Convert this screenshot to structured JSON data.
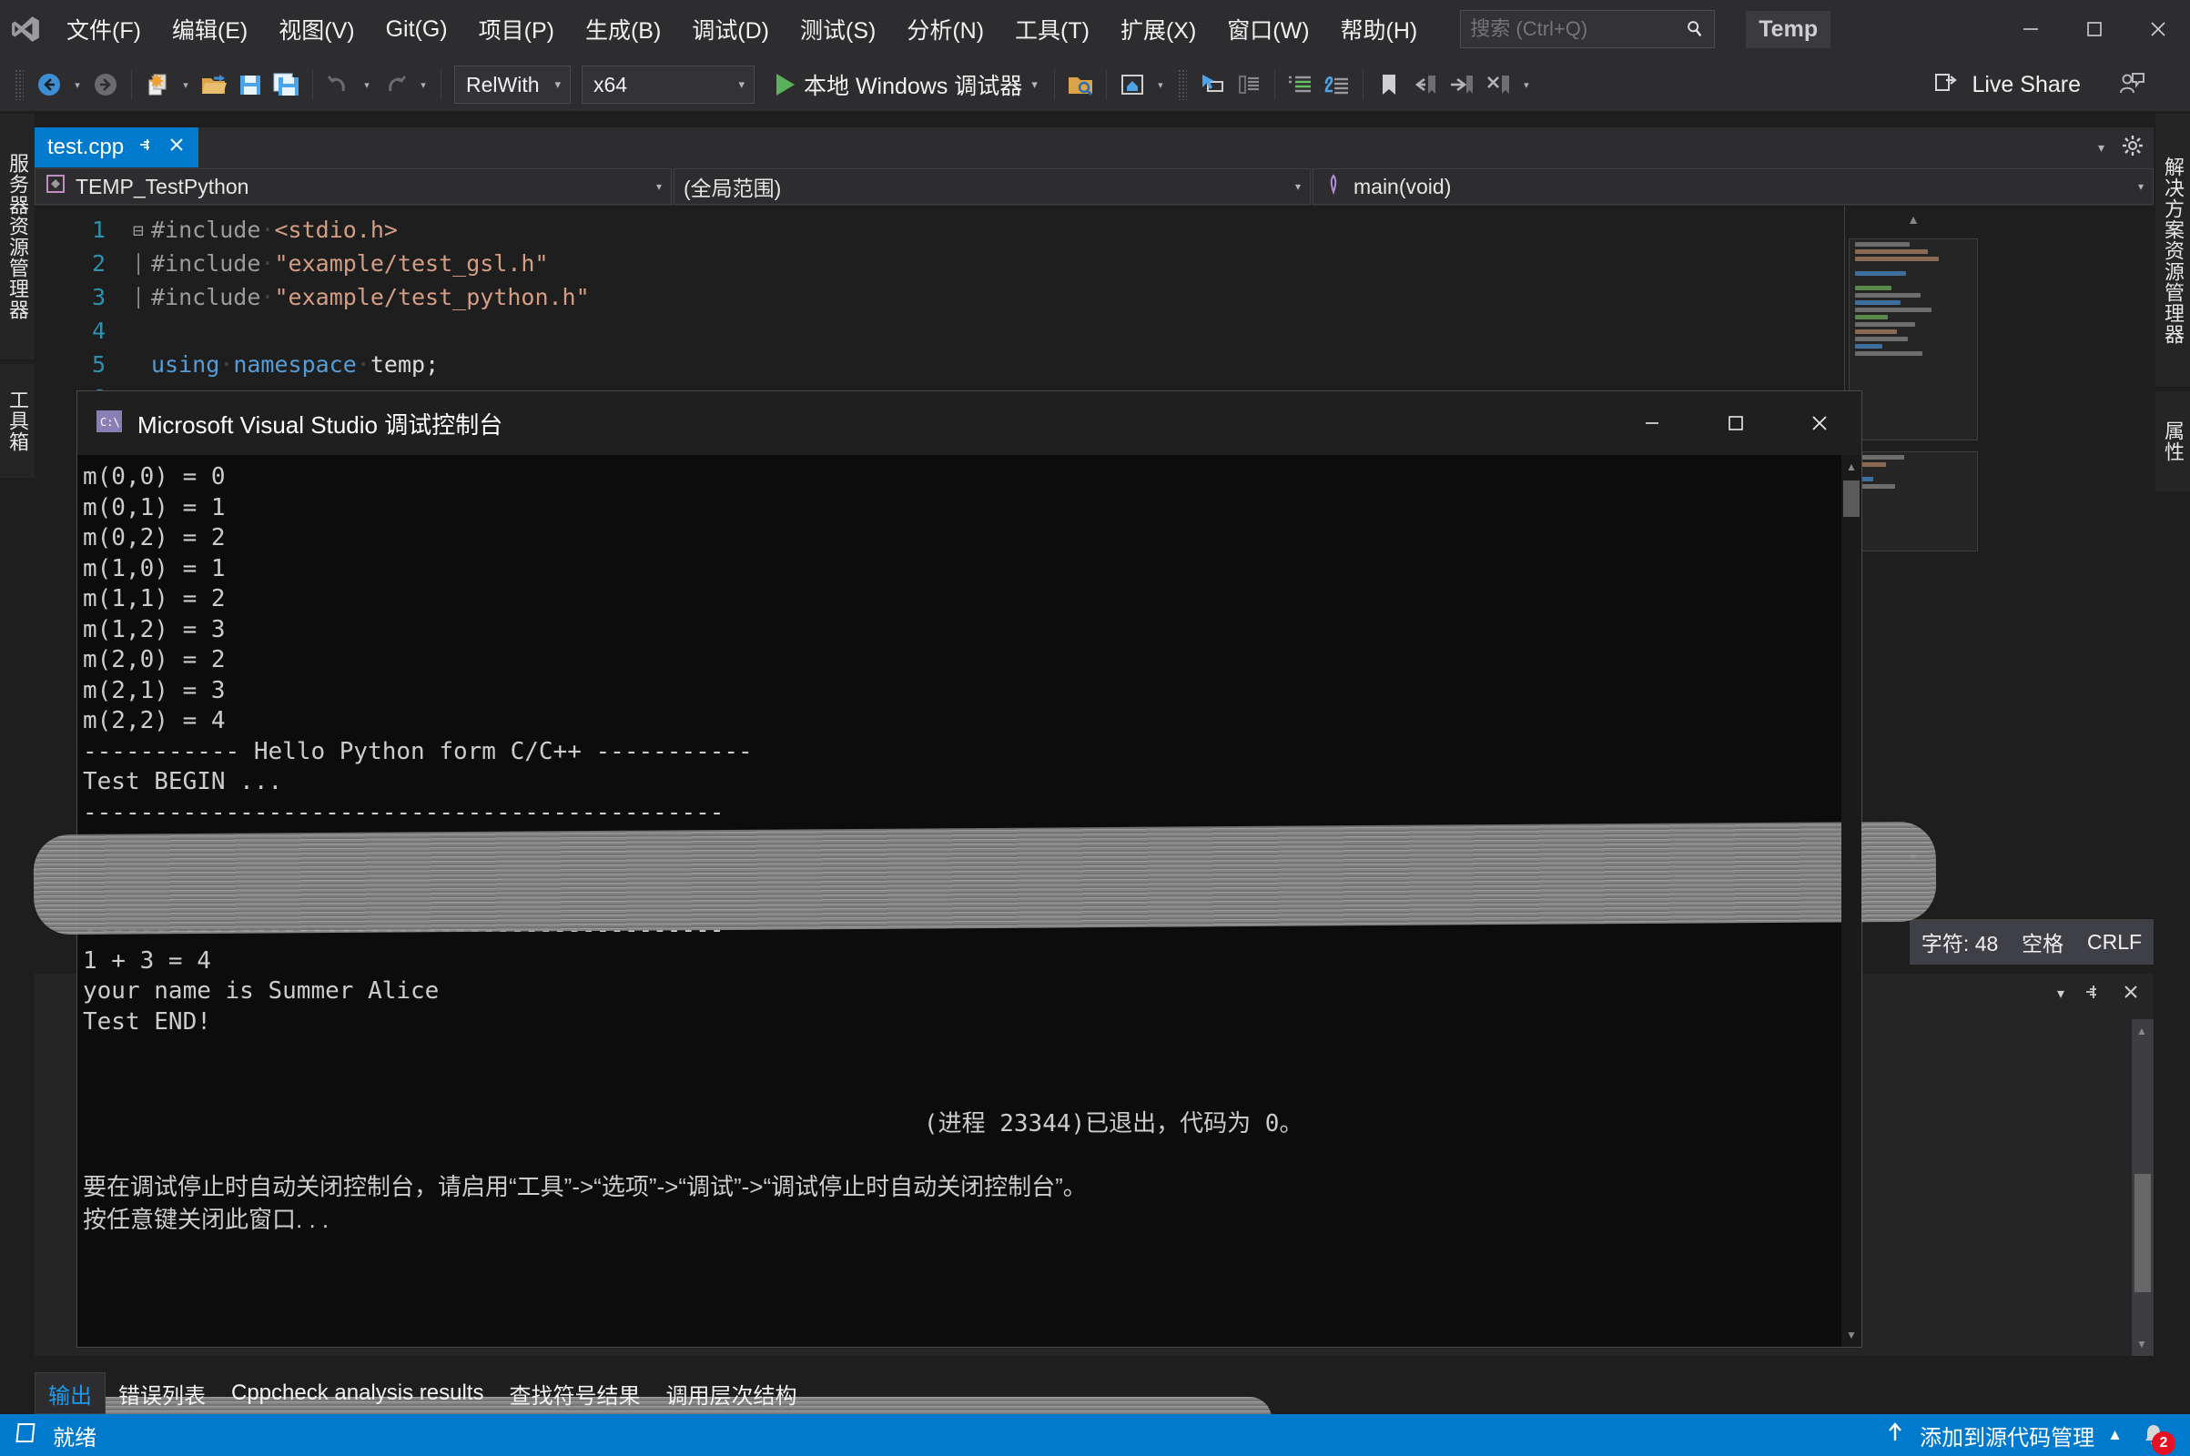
{
  "app": {
    "title_badge": "Temp",
    "live_share": "Live Share"
  },
  "menu": {
    "items": [
      {
        "label": "文件(F)"
      },
      {
        "label": "编辑(E)"
      },
      {
        "label": "视图(V)"
      },
      {
        "label": "Git(G)"
      },
      {
        "label": "项目(P)"
      },
      {
        "label": "生成(B)"
      },
      {
        "label": "调试(D)"
      },
      {
        "label": "测试(S)"
      },
      {
        "label": "分析(N)"
      },
      {
        "label": "工具(T)"
      },
      {
        "label": "扩展(X)"
      },
      {
        "label": "窗口(W)"
      },
      {
        "label": "帮助(H)"
      }
    ]
  },
  "search": {
    "placeholder": "搜索 (Ctrl+Q)"
  },
  "toolbar": {
    "configuration": "RelWith",
    "platform": "x64",
    "run_label": "本地 Windows 调试器"
  },
  "left_tool_tabs": [
    {
      "label": "服务器资源管理器"
    },
    {
      "label": "工具箱"
    }
  ],
  "right_tool_tabs": [
    {
      "label": "解决方案资源管理器"
    },
    {
      "label": "属性"
    }
  ],
  "document_tab": {
    "label": "test.cpp"
  },
  "editor_nav": {
    "project": "TEMP_TestPython",
    "scope": "(全局范围)",
    "member": "main(void)"
  },
  "code": {
    "lines": [
      {
        "no": "1",
        "fold": "⊟",
        "tokens": [
          {
            "t": "#include",
            "c": "c-pre"
          },
          {
            "t": "·",
            "c": "c-dot"
          },
          {
            "t": "<stdio.h>",
            "c": "c-str"
          }
        ]
      },
      {
        "no": "2",
        "fold": "│",
        "tokens": [
          {
            "t": "#include",
            "c": "c-pre"
          },
          {
            "t": "·",
            "c": "c-dot"
          },
          {
            "t": "\"example/test_gsl.h\"",
            "c": "c-str"
          }
        ]
      },
      {
        "no": "3",
        "fold": "│",
        "tokens": [
          {
            "t": "#include",
            "c": "c-pre"
          },
          {
            "t": "·",
            "c": "c-dot"
          },
          {
            "t": "\"example/test_python.h\"",
            "c": "c-str"
          }
        ]
      },
      {
        "no": "4",
        "fold": "",
        "tokens": []
      },
      {
        "no": "5",
        "fold": "",
        "tokens": [
          {
            "t": "using",
            "c": "c-kw"
          },
          {
            "t": "·",
            "c": "c-dot"
          },
          {
            "t": "namespace",
            "c": "c-kw"
          },
          {
            "t": "·",
            "c": "c-dot"
          },
          {
            "t": "temp;",
            "c": "c-id"
          }
        ]
      },
      {
        "no": "6",
        "fold": "",
        "tokens": []
      }
    ]
  },
  "console": {
    "title": "Microsoft Visual Studio 调试控制台",
    "lines": [
      "m(0,0) = 0",
      "m(0,1) = 1",
      "m(0,2) = 2",
      "m(1,0) = 1",
      "m(1,1) = 2",
      "m(1,2) = 3",
      "m(2,0) = 2",
      "m(2,1) = 3",
      "m(2,2) = 4",
      "----------- Hello Python form C/C++ -----------",
      "Test BEGIN ...",
      "---------------------------------------------"
    ],
    "lines_after": [
      "---------------------------------------------",
      "1 + 3 = 4",
      "your name is Summer Alice",
      "Test END!"
    ],
    "exit_message": "(进程 23344)已退出，代码为 0。",
    "hint_line_1": "要在调试停止时自动关闭控制台，请启用“工具”->“选项”->“调试”->“调试停止时自动关闭控制台”。",
    "hint_line_2": "按任意键关闭此窗口. . ."
  },
  "editor_status": {
    "chars": "字符: 48",
    "indent": "空格",
    "eol": "CRLF"
  },
  "bottom_tabs": [
    {
      "label": "输出",
      "active": true
    },
    {
      "label": "错误列表",
      "active": false
    },
    {
      "label": "Cppcheck analysis results",
      "active": false
    },
    {
      "label": "查找符号结果",
      "active": false
    },
    {
      "label": "调用层次结构",
      "active": false
    }
  ],
  "statusbar": {
    "state": "就绪",
    "source_control": "添加到源代码管理",
    "notification_count": "2"
  },
  "colors": {
    "accent": "#007acc",
    "titlebar_bg": "#2d2d30",
    "editor_bg": "#1e1e1e",
    "console_bg": "#0c0c0c",
    "badge_red": "#e81123",
    "run_green": "#59b15b"
  }
}
